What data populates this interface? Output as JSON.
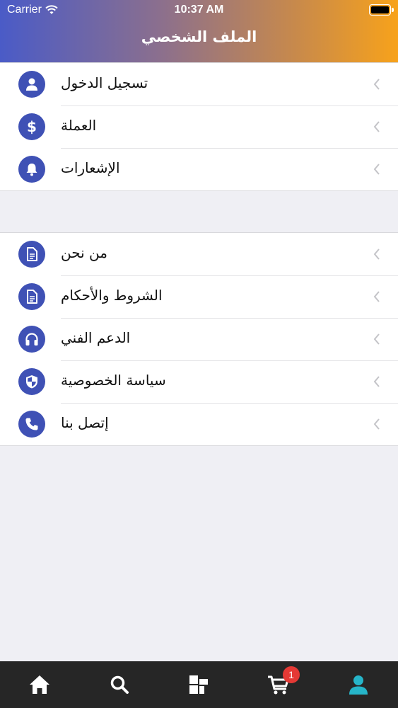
{
  "status_bar": {
    "carrier": "Carrier",
    "time": "10:37 AM"
  },
  "header": {
    "title": "الملف الشخصي"
  },
  "groups": [
    {
      "items": [
        {
          "label": "تسجيل الدخول",
          "icon": "user-icon"
        },
        {
          "label": "العملة",
          "icon": "dollar-icon"
        },
        {
          "label": "الإشعارات",
          "icon": "bell-icon"
        }
      ]
    },
    {
      "items": [
        {
          "label": "من نحن",
          "icon": "document-icon"
        },
        {
          "label": "الشروط والأحكام",
          "icon": "document-icon"
        },
        {
          "label": "الدعم الفني",
          "icon": "headphones-icon"
        },
        {
          "label": "سياسة الخصوصية",
          "icon": "shield-icon"
        },
        {
          "label": "إتصل بنا",
          "icon": "phone-icon"
        }
      ]
    }
  ],
  "tabbar": {
    "tabs": [
      "home-icon",
      "search-icon",
      "categories-icon",
      "cart-icon",
      "profile-icon"
    ],
    "cart_badge": "1",
    "active_tab": "profile-icon"
  },
  "colors": {
    "icon_bg": "#3f51b5",
    "active_tab": "#26b5c9",
    "inactive_tab": "#ffffff",
    "badge": "#e53935"
  }
}
